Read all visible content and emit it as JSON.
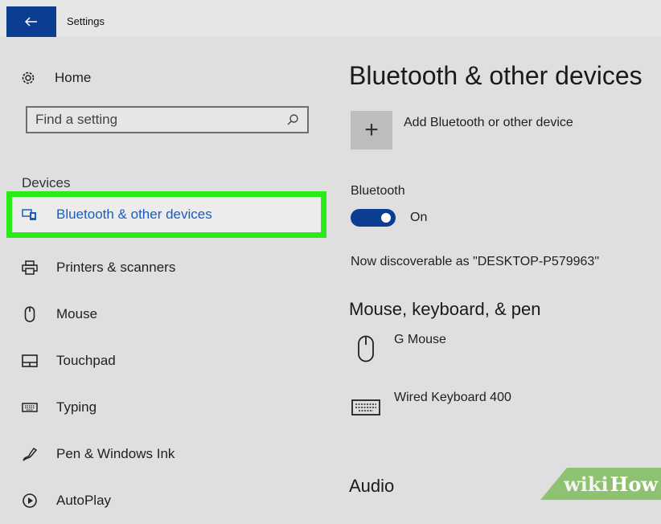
{
  "window": {
    "title": "Settings",
    "back_icon": "arrow-left-icon"
  },
  "sidebar": {
    "home_label": "Home",
    "search_placeholder": "Find a setting",
    "section_label": "Devices",
    "items": [
      {
        "label": "Bluetooth & other devices",
        "icon": "bluetooth-devices-icon",
        "active": true
      },
      {
        "label": "Printers & scanners",
        "icon": "printer-icon",
        "active": false
      },
      {
        "label": "Mouse",
        "icon": "mouse-icon",
        "active": false
      },
      {
        "label": "Touchpad",
        "icon": "touchpad-icon",
        "active": false
      },
      {
        "label": "Typing",
        "icon": "keyboard-icon",
        "active": false
      },
      {
        "label": "Pen & Windows Ink",
        "icon": "pen-icon",
        "active": false
      },
      {
        "label": "AutoPlay",
        "icon": "autoplay-icon",
        "active": false
      }
    ]
  },
  "main": {
    "title": "Bluetooth & other devices",
    "add_device_label": "Add Bluetooth or other device",
    "bluetooth": {
      "label": "Bluetooth",
      "toggle_state": "On",
      "discoverable_text": "Now discoverable as \"DESKTOP-P579963\""
    },
    "mouse_section": {
      "heading": "Mouse, keyboard, & pen",
      "devices": [
        {
          "name": "G Mouse",
          "icon": "mouse-icon"
        },
        {
          "name": "Wired Keyboard 400",
          "icon": "keyboard-icon"
        }
      ]
    },
    "audio_heading": "Audio"
  },
  "watermark": {
    "part1": "wiki",
    "part2": "How"
  },
  "colors": {
    "accent": "#0b3d91",
    "highlight": "#2bea1a",
    "active_text": "#1a5dbf",
    "background": "#dfdfdf"
  }
}
